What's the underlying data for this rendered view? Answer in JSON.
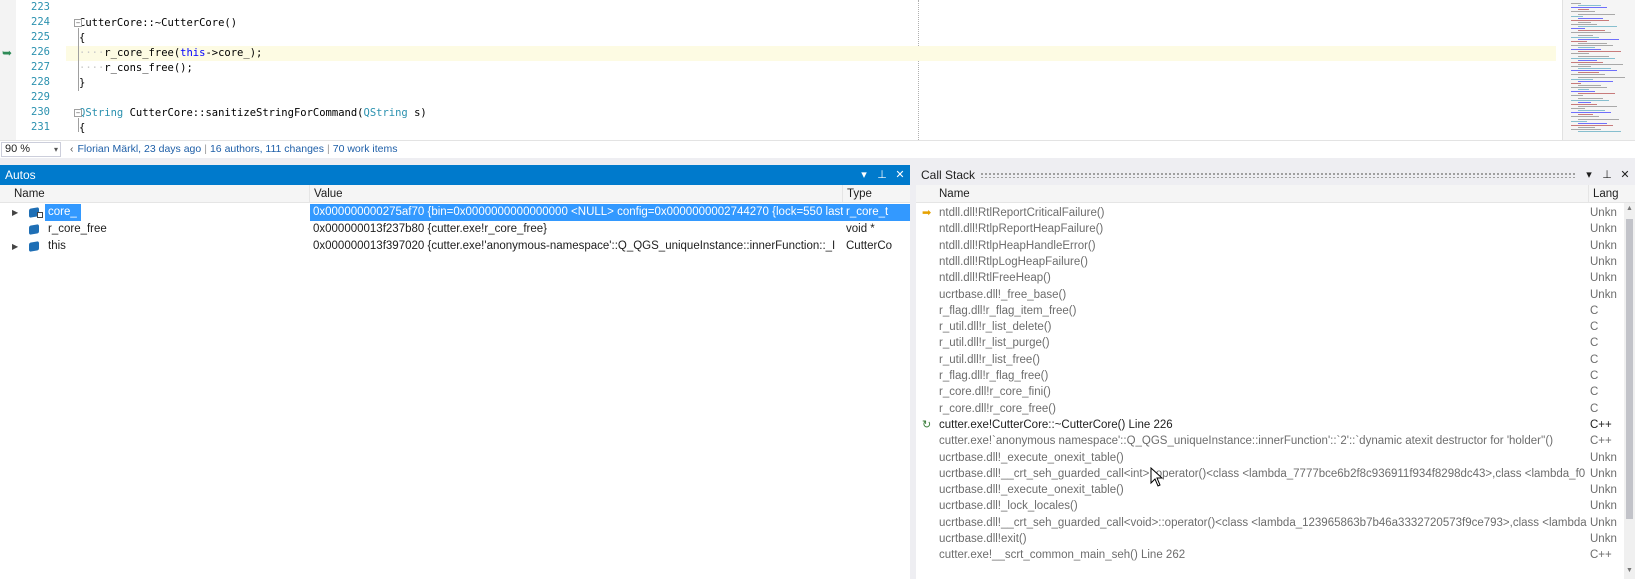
{
  "editor": {
    "lines": [
      {
        "num": "223",
        "text": ""
      },
      {
        "num": "224",
        "text": "CutterCore::~CutterCore()"
      },
      {
        "num": "225",
        "text": "{"
      },
      {
        "num": "226",
        "text": "r_core_free(this->core_);"
      },
      {
        "num": "227",
        "text": "r_cons_free();"
      },
      {
        "num": "228",
        "text": "}"
      },
      {
        "num": "229",
        "text": ""
      },
      {
        "num": "230",
        "text": "QString CutterCore::sanitizeStringForCommand(QString s)"
      },
      {
        "num": "231",
        "text": "{"
      }
    ],
    "ws_indent": "····",
    "kw_this": "this",
    "kw_arrow": "->core_);",
    "fn_free": "r_core_free(",
    "fn_cons": "r_cons_free();",
    "type_qstring": "QString",
    "sig_rest": "CutterCore::sanitizeStringForCommand(",
    "sig_param": "s)",
    "dtor": "CutterCore::~CutterCore()",
    "brace_open": "{",
    "brace_close": "}",
    "collapse_symbol": "−"
  },
  "status": {
    "zoom": "90 %",
    "zoom_arrow": "▾",
    "codelens_chevron": "‹",
    "author": "Florian Märkl, 23 days ago",
    "authors_changes": "16 authors, 111 changes",
    "work_items": "70 work items",
    "separator": "|"
  },
  "autos": {
    "title": "Autos",
    "columns": {
      "name": "Name",
      "value": "Value",
      "type": "Type"
    },
    "rows": [
      {
        "name": "core_",
        "value": "0x000000000275af70 {bin=0x0000000000000000 <NULL> config=0x0000000002744270 {lock=550 last_",
        "type": "r_core_t",
        "expand": "▶",
        "selected": true
      },
      {
        "name": "r_core_free",
        "value": "0x000000013f237b80 {cutter.exe!r_core_free}",
        "type": "void *",
        "expand": ""
      },
      {
        "name": "this",
        "value": "0x000000013f397020 {cutter.exe!'anonymous-namespace'::Q_QGS_uniqueInstance::innerFunction::_I",
        "type": "CutterCo",
        "expand": "▶"
      }
    ],
    "buttons": {
      "dropdown": "▾",
      "pin": "⊥",
      "close": "✕"
    }
  },
  "callstack": {
    "title": "Call Stack",
    "columns": {
      "name": "Name",
      "lang": "Lang"
    },
    "frames": [
      {
        "name": "ntdll.dll!RtlReportCriticalFailure()",
        "lang": "Unkn",
        "icon": "yellow"
      },
      {
        "name": "ntdll.dll!RtlpReportHeapFailure()",
        "lang": "Unkn"
      },
      {
        "name": "ntdll.dll!RtlpHeapHandleError()",
        "lang": "Unkn"
      },
      {
        "name": "ntdll.dll!RtlpLogHeapFailure()",
        "lang": "Unkn"
      },
      {
        "name": "ntdll.dll!RtlFreeHeap()",
        "lang": "Unkn"
      },
      {
        "name": "ucrtbase.dll!_free_base()",
        "lang": "Unkn"
      },
      {
        "name": "r_flag.dll!r_flag_item_free()",
        "lang": "C"
      },
      {
        "name": "r_util.dll!r_list_delete()",
        "lang": "C"
      },
      {
        "name": "r_util.dll!r_list_purge()",
        "lang": "C"
      },
      {
        "name": "r_util.dll!r_list_free()",
        "lang": "C"
      },
      {
        "name": "r_flag.dll!r_flag_free()",
        "lang": "C"
      },
      {
        "name": "r_core.dll!r_core_fini()",
        "lang": "C"
      },
      {
        "name": "r_core.dll!r_core_free()",
        "lang": "C"
      },
      {
        "name": "cutter.exe!CutterCore::~CutterCore() Line 226",
        "lang": "C++",
        "icon": "green",
        "strong": true
      },
      {
        "name": "cutter.exe!`anonymous namespace'::Q_QGS_uniqueInstance::innerFunction'::`2'::`dynamic atexit destructor for 'holder''()",
        "lang": "C++"
      },
      {
        "name": "ucrtbase.dll!_execute_onexit_table()",
        "lang": "Unkn"
      },
      {
        "name": "ucrtbase.dll!__crt_seh_guarded_call<int>::operator()<class <lambda_7777bce6b2f8c936911f934f8298dc43>,class <lambda_f0",
        "lang": "Unkn"
      },
      {
        "name": "ucrtbase.dll!_execute_onexit_table()",
        "lang": "Unkn"
      },
      {
        "name": "ucrtbase.dll!_lock_locales()",
        "lang": "Unkn"
      },
      {
        "name": "ucrtbase.dll!__crt_seh_guarded_call<void>::operator()<class <lambda_123965863b7b46a3332720573f9ce793>,class <lambda",
        "lang": "Unkn"
      },
      {
        "name": "ucrtbase.dll!exit()",
        "lang": "Unkn"
      },
      {
        "name": "cutter.exe!__scrt_common_main_seh() Line 262",
        "lang": "C++"
      }
    ],
    "buttons": {
      "dropdown": "▾",
      "pin": "⊥",
      "close": "✕"
    },
    "icons": {
      "yellow": "➡",
      "green": "↻"
    }
  },
  "colors": {
    "accent": "#007acc",
    "selection": "#3399ff",
    "line_number": "#2b91af",
    "keyword": "#0000ff"
  }
}
